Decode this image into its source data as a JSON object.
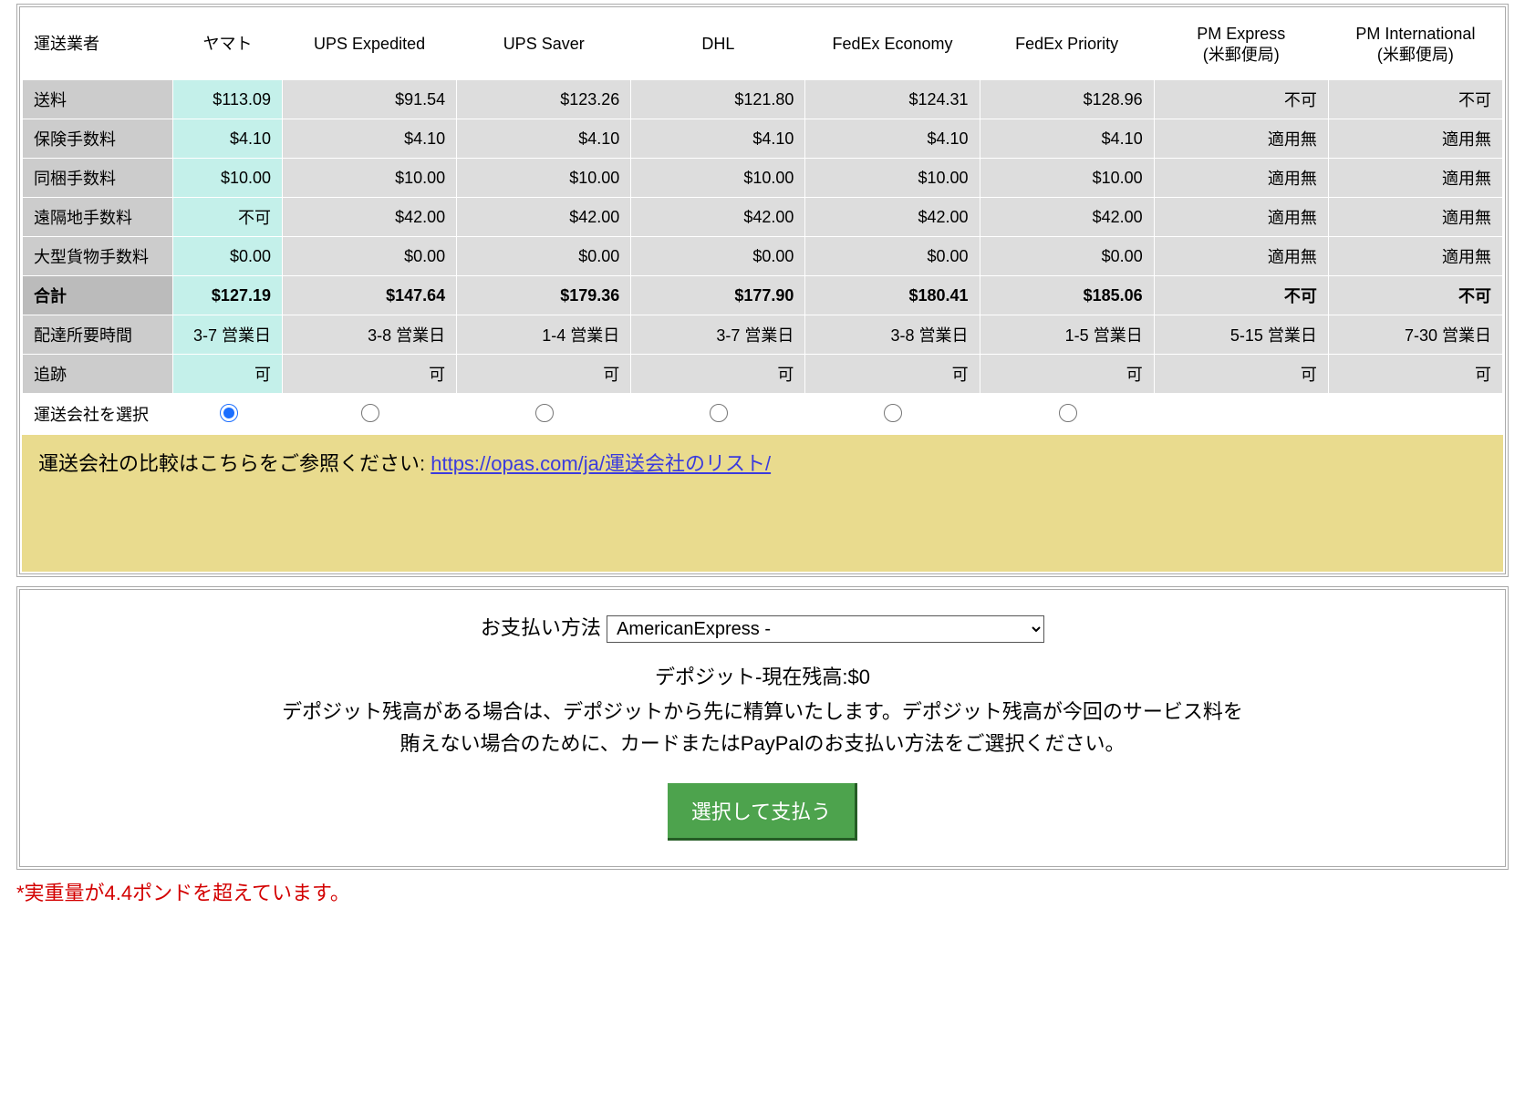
{
  "table": {
    "header_first": "運送業者",
    "carriers": [
      {
        "name": "ヤマト",
        "sub": ""
      },
      {
        "name": "UPS Expedited",
        "sub": ""
      },
      {
        "name": "UPS Saver",
        "sub": ""
      },
      {
        "name": "DHL",
        "sub": ""
      },
      {
        "name": "FedEx Economy",
        "sub": ""
      },
      {
        "name": "FedEx Priority",
        "sub": ""
      },
      {
        "name": "PM Express",
        "sub": "(米郵便局)"
      },
      {
        "name": "PM International",
        "sub": "(米郵便局)"
      }
    ],
    "rows": [
      {
        "label": "送料",
        "vals": [
          "$113.09",
          "$91.54",
          "$123.26",
          "$121.80",
          "$124.31",
          "$128.96",
          "不可",
          "不可"
        ]
      },
      {
        "label": "保険手数料",
        "vals": [
          "$4.10",
          "$4.10",
          "$4.10",
          "$4.10",
          "$4.10",
          "$4.10",
          "適用無",
          "適用無"
        ]
      },
      {
        "label": "同梱手数料",
        "vals": [
          "$10.00",
          "$10.00",
          "$10.00",
          "$10.00",
          "$10.00",
          "$10.00",
          "適用無",
          "適用無"
        ]
      },
      {
        "label": "遠隔地手数料",
        "vals": [
          "不可",
          "$42.00",
          "$42.00",
          "$42.00",
          "$42.00",
          "$42.00",
          "適用無",
          "適用無"
        ]
      },
      {
        "label": "大型貨物手数料",
        "vals": [
          "$0.00",
          "$0.00",
          "$0.00",
          "$0.00",
          "$0.00",
          "$0.00",
          "適用無",
          "適用無"
        ]
      },
      {
        "label": "合計",
        "vals": [
          "$127.19",
          "$147.64",
          "$179.36",
          "$177.90",
          "$180.41",
          "$185.06",
          "不可",
          "不可"
        ],
        "total": true
      },
      {
        "label": "配達所要時間",
        "vals": [
          "3-7 営業日",
          "3-8 営業日",
          "1-4 営業日",
          "3-7 営業日",
          "3-8 営業日",
          "1-5 営業日",
          "5-15 営業日",
          "7-30 営業日"
        ]
      },
      {
        "label": "追跡",
        "vals": [
          "可",
          "可",
          "可",
          "可",
          "可",
          "可",
          "可",
          "可"
        ]
      }
    ],
    "select_label": "運送会社を選択",
    "highlight_col": 0,
    "selected": 0,
    "selectable_cols": 6
  },
  "notice": {
    "text_prefix": "運送会社の比較はこちらをご参照ください: ",
    "link_text": "https://opas.com/ja/運送会社のリスト/"
  },
  "payment": {
    "label": "お支払い方法",
    "selected_option": "AmericanExpress -",
    "deposit_line": "デポジット-現在残高:$0",
    "desc1": "デポジット残高がある場合は、デポジットから先に精算いたします。デポジット残高が今回のサービス料を",
    "desc2": "賄えない場合のために、カードまたはPayPalのお支払い方法をご選択ください。",
    "button": "選択して支払う"
  },
  "footnote": "*実重量が4.4ポンドを超えています。"
}
